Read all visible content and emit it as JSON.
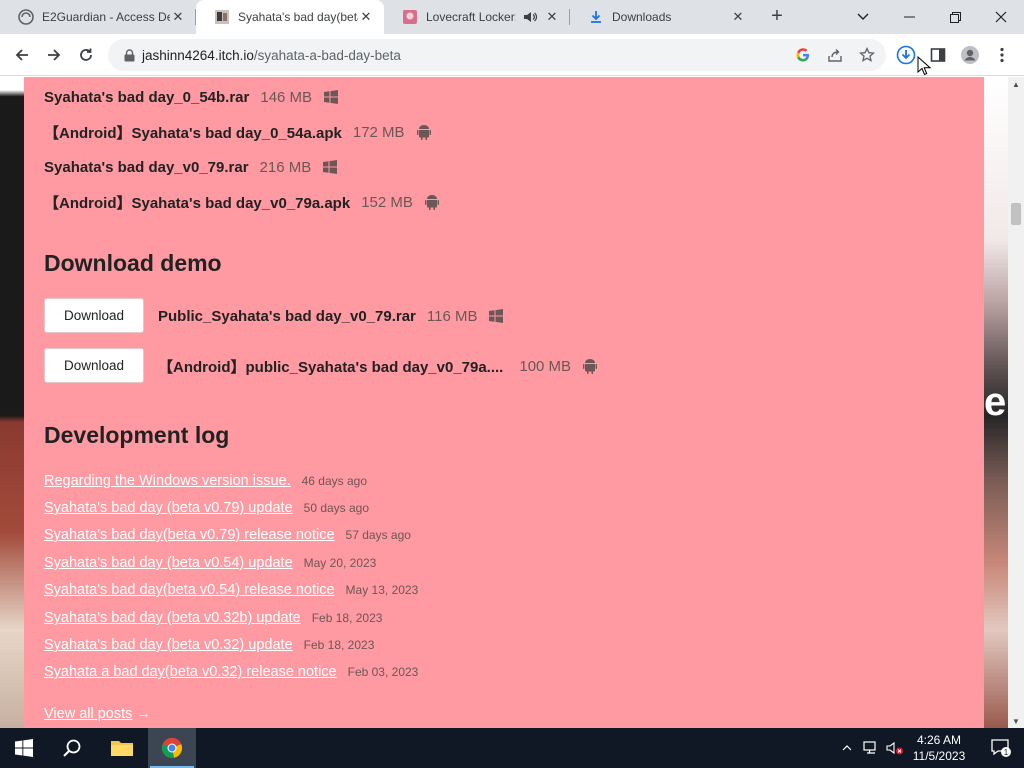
{
  "tabs": [
    {
      "title": "E2Guardian - Access De",
      "icon": "e2guardian-icon",
      "active": false
    },
    {
      "title": "Syahata's bad day(beta",
      "icon": "itch-game-icon",
      "active": true
    },
    {
      "title": "Lovecraft Locker: T",
      "icon": "lovecraft-icon",
      "active": false,
      "audio": true
    },
    {
      "title": "Downloads",
      "icon": "download-icon",
      "active": false
    }
  ],
  "address_bar": {
    "domain": "jashinn4264.itch.io",
    "path": "/syahata-a-bad-day-beta"
  },
  "files": [
    {
      "name": "Syahata's bad day_0_54b.rar",
      "size": "146 MB",
      "platform": "windows"
    },
    {
      "name": "【Android】Syahata's bad day_0_54a.apk",
      "size": "172 MB",
      "platform": "android"
    },
    {
      "name": "Syahata's bad day_v0_79.rar",
      "size": "216 MB",
      "platform": "windows"
    },
    {
      "name": "【Android】Syahata's bad day_v0_79a.apk",
      "size": "152 MB",
      "platform": "android"
    }
  ],
  "demo": {
    "heading": "Download demo",
    "button_label": "Download",
    "files": [
      {
        "name": "Public_Syahata's bad day_v0_79.rar",
        "size": "116 MB",
        "platform": "windows"
      },
      {
        "name": "【Android】public_Syahata's bad day_v0_79a....",
        "size": "100 MB",
        "platform": "android"
      }
    ]
  },
  "devlog": {
    "heading": "Development log",
    "posts": [
      {
        "title": "Regarding the Windows version issue.",
        "date": "46 days ago"
      },
      {
        "title": "Syahata's bad day (beta v0.79) update",
        "date": "50 days ago"
      },
      {
        "title": "Syahata's bad day(beta v0.79) release notice",
        "date": "57 days ago"
      },
      {
        "title": "Syahata's bad day (beta v0.54) update",
        "date": "May 20, 2023"
      },
      {
        "title": "Syahata's bad day(beta v0.54) release notice",
        "date": "May 13, 2023"
      },
      {
        "title": "Syahata's bad day (beta v0.32b) update",
        "date": "Feb 18, 2023"
      },
      {
        "title": "Syahata's bad day (beta v0.32) update",
        "date": "Feb 18, 2023"
      },
      {
        "title": "Syahata a bad day(beta v0.32) release notice",
        "date": "Feb 03, 2023"
      }
    ],
    "view_all": "View all posts",
    "view_all_arrow": "→"
  },
  "background_text": "er",
  "taskbar": {
    "time": "4:26 AM",
    "date": "11/5/2023",
    "notification_count": "1"
  },
  "colors": {
    "page_bg": "#ff9aa2",
    "link": "#ffffff",
    "text": "#222222"
  }
}
